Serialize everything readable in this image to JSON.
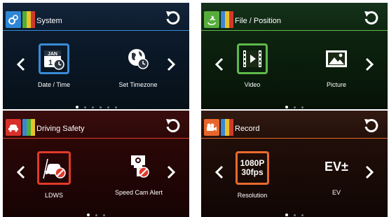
{
  "panels": {
    "system": {
      "title": "System",
      "items": [
        {
          "label": "Date / Time",
          "icon": "calendar-clock-icon",
          "selected": true
        },
        {
          "label": "Set Timezone",
          "icon": "globe-clock-icon",
          "selected": false
        }
      ],
      "page_count": 6,
      "active_page": 1,
      "accent": "#3a8bd8"
    },
    "file": {
      "title": "File / Position",
      "items": [
        {
          "label": "Video",
          "icon": "film-icon",
          "selected": true
        },
        {
          "label": "Picture",
          "icon": "picture-icon",
          "selected": false
        }
      ],
      "page_count": 3,
      "active_page": 1,
      "accent": "#5fb94a"
    },
    "drive": {
      "title": "Driving Safety",
      "items": [
        {
          "label": "LDWS",
          "icon": "car-lane-warning-icon",
          "selected": true
        },
        {
          "label": "Speed Cam Alert",
          "icon": "speed-camera-icon",
          "selected": false
        }
      ],
      "page_count": 3,
      "active_page": 1,
      "accent": "#e23a2a"
    },
    "record": {
      "title": "Record",
      "items": [
        {
          "label": "Resolution",
          "icon": "resolution-icon",
          "selected": true,
          "line1": "1080P",
          "line2": "30fps"
        },
        {
          "label": "EV",
          "icon": "ev-icon",
          "selected": false,
          "text": "EV±"
        }
      ],
      "page_count": 3,
      "active_page": 1,
      "accent": "#e86a2e"
    }
  },
  "calendar_month": "JAN",
  "calendar_day": "1"
}
